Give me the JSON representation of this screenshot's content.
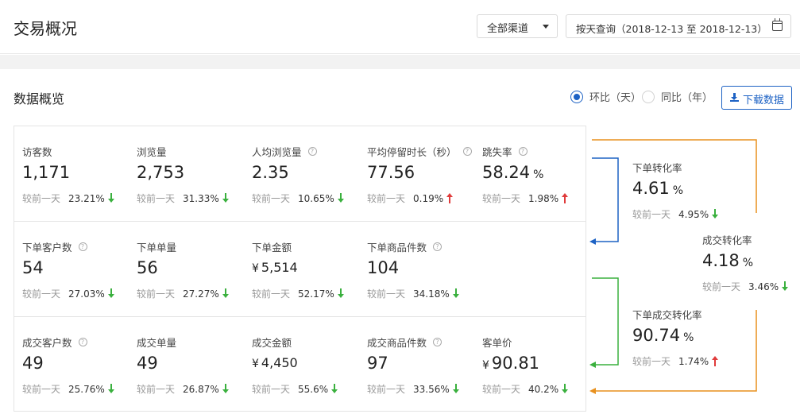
{
  "header": {
    "title": "交易概况",
    "channel": "全部渠道",
    "date_range": "按天查询（2018-12-13 至 2018-12-13）"
  },
  "overview": {
    "title": "数据概览",
    "radio_chain": "环比（天）",
    "radio_yoy": "同比（年）",
    "download": "下载数据",
    "compare_label": "较前一天"
  },
  "rows": [
    [
      {
        "label": "访客数",
        "help": false,
        "value": "1,171",
        "unit": "",
        "prefix": "",
        "pct": "23.21%",
        "trend": "down"
      },
      {
        "label": "浏览量",
        "help": false,
        "value": "2,753",
        "unit": "",
        "prefix": "",
        "pct": "31.33%",
        "trend": "down"
      },
      {
        "label": "人均浏览量",
        "help": true,
        "value": "2.35",
        "unit": "",
        "prefix": "",
        "pct": "10.65%",
        "trend": "down"
      },
      {
        "label": "平均停留时长（秒）",
        "help": true,
        "value": "77.56",
        "unit": "",
        "prefix": "",
        "pct": "0.19%",
        "trend": "up"
      },
      {
        "label": "跳失率",
        "help": true,
        "value": "58.24",
        "unit": "%",
        "prefix": "",
        "pct": "1.98%",
        "trend": "up"
      }
    ],
    [
      {
        "label": "下单客户数",
        "help": true,
        "value": "54",
        "unit": "",
        "prefix": "",
        "pct": "27.03%",
        "trend": "down"
      },
      {
        "label": "下单单量",
        "help": false,
        "value": "56",
        "unit": "",
        "prefix": "",
        "pct": "27.27%",
        "trend": "down"
      },
      {
        "label": "下单金额",
        "help": false,
        "value": "5,514",
        "unit": "",
        "prefix": "¥",
        "pct": "52.17%",
        "trend": "down"
      },
      {
        "label": "下单商品件数",
        "help": true,
        "value": "104",
        "unit": "",
        "prefix": "",
        "pct": "34.18%",
        "trend": "down"
      }
    ],
    [
      {
        "label": "成交客户数",
        "help": true,
        "value": "49",
        "unit": "",
        "prefix": "",
        "pct": "25.76%",
        "trend": "down"
      },
      {
        "label": "成交单量",
        "help": false,
        "value": "49",
        "unit": "",
        "prefix": "",
        "pct": "26.87%",
        "trend": "down"
      },
      {
        "label": "成交金额",
        "help": false,
        "value": "4,450",
        "unit": "",
        "prefix": "¥",
        "pct": "55.6%",
        "trend": "down"
      },
      {
        "label": "成交商品件数",
        "help": true,
        "value": "97",
        "unit": "",
        "prefix": "",
        "pct": "33.56%",
        "trend": "down"
      },
      {
        "label": "客单价",
        "help": false,
        "value": "90.81",
        "unit": "",
        "prefix": "¥",
        "pct": "40.2%",
        "trend": "down"
      }
    ]
  ],
  "conversions": [
    {
      "label": "下单转化率",
      "value": "4.61",
      "unit": "%",
      "pct": "4.95%",
      "trend": "down"
    },
    {
      "label": "成交转化率",
      "value": "4.18",
      "unit": "%",
      "pct": "3.46%",
      "trend": "down"
    },
    {
      "label": "下单成交转化率",
      "value": "90.74",
      "unit": "%",
      "pct": "1.74%",
      "trend": "up"
    }
  ],
  "colors": {
    "accent": "#1d62c4",
    "down": "#3ab03e",
    "up": "#e03b3b",
    "flow_orange": "#e8911e",
    "flow_blue": "#1d62c4",
    "flow_green": "#3ab03e"
  }
}
